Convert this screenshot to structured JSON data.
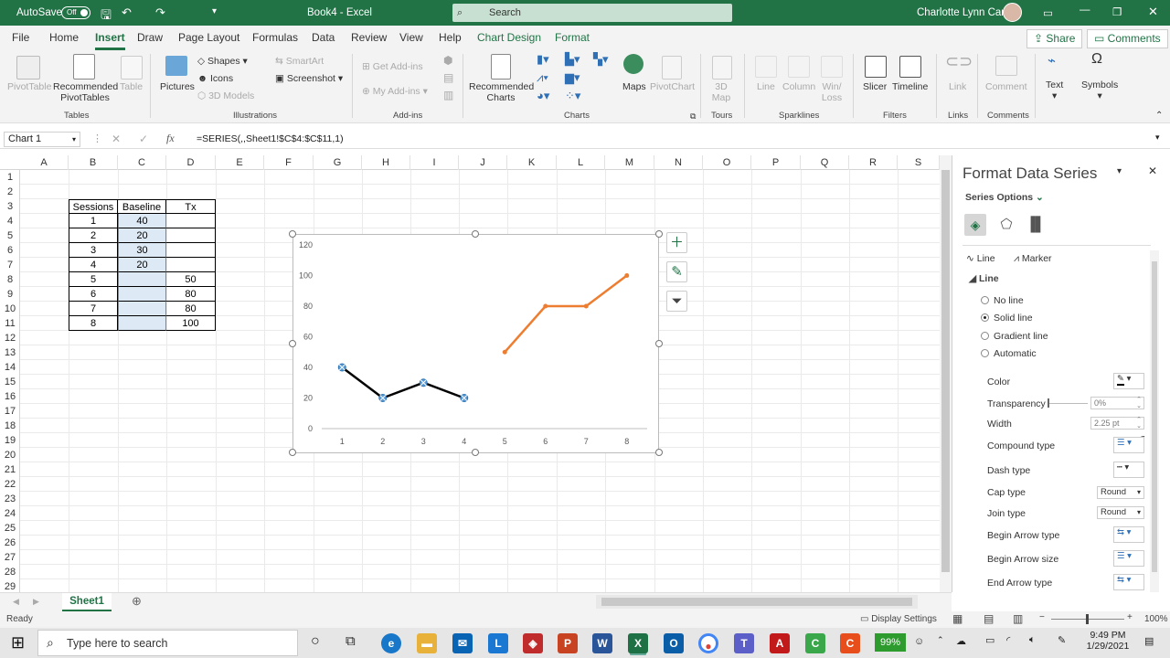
{
  "titlebar": {
    "autosave": "AutoSave",
    "autosave_state": "Off",
    "title": "Book4  -  Excel",
    "search_placeholder": "Search",
    "user": "Charlotte Lynn Carp"
  },
  "menu": {
    "tabs": [
      "File",
      "Home",
      "Insert",
      "Draw",
      "Page Layout",
      "Formulas",
      "Data",
      "Review",
      "View",
      "Help",
      "Chart Design",
      "Format"
    ],
    "share": "Share",
    "comments": "Comments"
  },
  "ribbon": {
    "tables": {
      "pivot": "PivotTable",
      "recommended": "Recommended PivotTables",
      "table": "Table",
      "group": "Tables"
    },
    "illustrations": {
      "pictures": "Pictures",
      "shapes": "Shapes",
      "icons": "Icons",
      "models": "3D Models",
      "smartart": "SmartArt",
      "screenshot": "Screenshot",
      "group": "Illustrations"
    },
    "addins": {
      "get": "Get Add-ins",
      "my": "My Add-ins",
      "group": "Add-ins"
    },
    "charts": {
      "recommended": "Recommended Charts",
      "maps": "Maps",
      "pivotchart": "PivotChart",
      "group": "Charts"
    },
    "tours": {
      "map3d": "3D Map",
      "group": "Tours"
    },
    "sparklines": {
      "line": "Line",
      "column": "Column",
      "winloss": "Win/ Loss",
      "group": "Sparklines"
    },
    "filters": {
      "slicer": "Slicer",
      "timeline": "Timeline",
      "group": "Filters"
    },
    "links": {
      "link": "Link",
      "group": "Links"
    },
    "comments": {
      "comment": "Comment",
      "group": "Comments"
    },
    "text": {
      "text": "Text",
      "symbols": "Symbols"
    }
  },
  "formula_bar": {
    "name_box": "Chart 1",
    "formula": "=SERIES(,,Sheet1!$C$4:$C$11,1)"
  },
  "columns": [
    "A",
    "B",
    "C",
    "D",
    "E",
    "F",
    "G",
    "H",
    "I",
    "J",
    "K",
    "L",
    "M",
    "N",
    "O",
    "P",
    "Q",
    "R",
    "S"
  ],
  "rows": [
    "1",
    "2",
    "3",
    "4",
    "5",
    "6",
    "7",
    "8",
    "9",
    "10",
    "11",
    "12",
    "13",
    "14",
    "15",
    "16",
    "17",
    "18",
    "19",
    "20",
    "21",
    "22",
    "23",
    "24",
    "25",
    "26",
    "27",
    "28",
    "29"
  ],
  "table": {
    "headers": [
      "Sessions",
      "Baseline",
      "Tx"
    ],
    "rows": [
      [
        "1",
        "40",
        ""
      ],
      [
        "2",
        "20",
        ""
      ],
      [
        "3",
        "30",
        ""
      ],
      [
        "4",
        "20",
        ""
      ],
      [
        "5",
        "",
        "50"
      ],
      [
        "6",
        "",
        "80"
      ],
      [
        "7",
        "",
        "80"
      ],
      [
        "8",
        "",
        "100"
      ]
    ]
  },
  "chart_data": {
    "type": "line",
    "x": [
      1,
      2,
      3,
      4,
      5,
      6,
      7,
      8
    ],
    "series": [
      {
        "values": [
          40,
          20,
          30,
          20,
          null,
          null,
          null,
          null
        ],
        "color": "#000000",
        "markers": true
      },
      {
        "values": [
          null,
          null,
          null,
          null,
          50,
          80,
          80,
          100
        ],
        "color": "#ED7D31",
        "markers": false
      }
    ],
    "ylim": [
      0,
      120
    ],
    "yticks": [
      "0",
      "20",
      "40",
      "60",
      "80",
      "100",
      "120"
    ],
    "xticks": [
      "1",
      "2",
      "3",
      "4",
      "5",
      "6",
      "7",
      "8"
    ],
    "grid": false,
    "legend": "none"
  },
  "sheet_tab": "Sheet1",
  "panel": {
    "title": "Format Data Series",
    "series_options": "Series Options",
    "tab_line": "Line",
    "tab_marker": "Marker",
    "section": "Line",
    "options": [
      "No line",
      "Solid line",
      "Gradient line",
      "Automatic"
    ],
    "selected": "Solid line",
    "color": "Color",
    "transparency": "Transparency",
    "transparency_value": "0%",
    "width": "Width",
    "width_value": "2.25 pt",
    "compound": "Compound type",
    "dash": "Dash type",
    "cap": "Cap type",
    "cap_value": "Round",
    "join": "Join type",
    "join_value": "Round",
    "begin_arrow_type": "Begin Arrow type",
    "begin_arrow_size": "Begin Arrow size",
    "end_arrow_type": "End Arrow type"
  },
  "status": {
    "ready": "Ready",
    "display": "Display Settings",
    "zoom": "100%"
  },
  "taskbar": {
    "search": "Type here to search",
    "battery": "99%",
    "time": "9:49 PM",
    "date": "1/29/2021"
  }
}
